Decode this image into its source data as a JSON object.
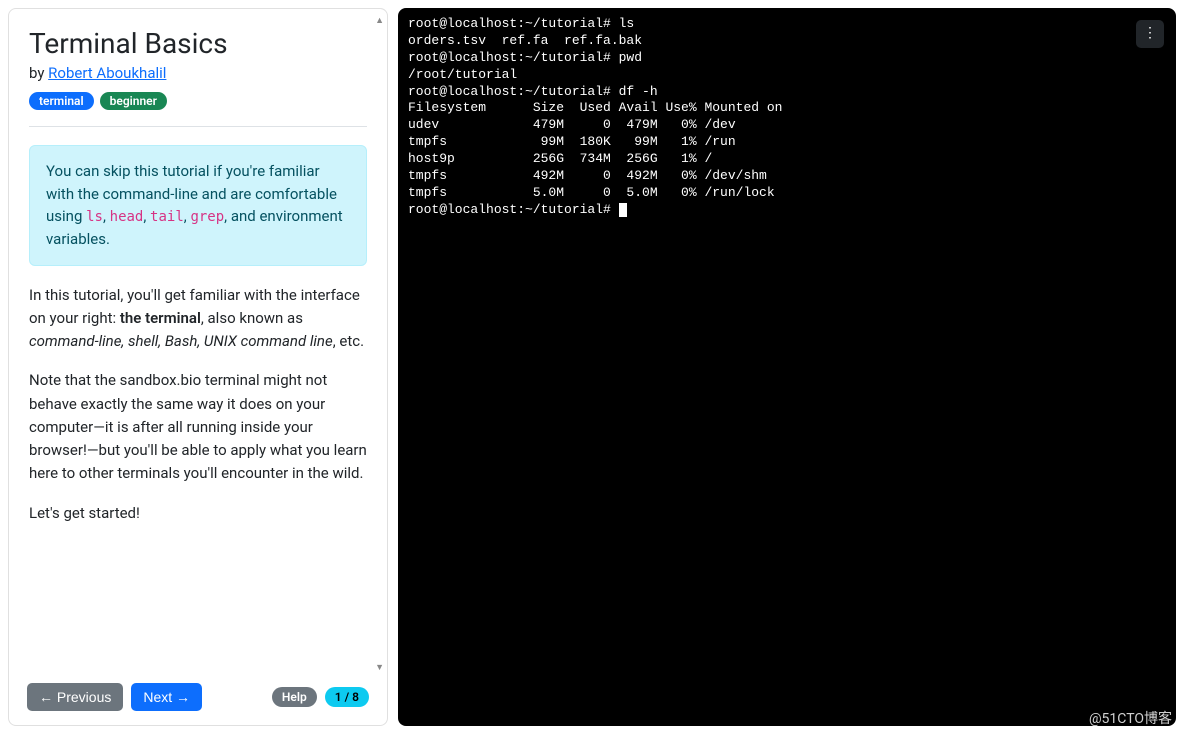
{
  "sidebar": {
    "title": "Terminal Basics",
    "by_prefix": "by ",
    "author_name": "Robert Aboukhalil",
    "tags": [
      "terminal",
      "beginner"
    ],
    "callout": {
      "pre": "You can skip this tutorial if you're familiar with the command-line and are comfortable using ",
      "codes": [
        "ls",
        "head",
        "tail",
        "grep"
      ],
      "post": ", and environment variables."
    },
    "para1_pre": "In this tutorial, you'll get familiar with the interface on your right: ",
    "para1_bold": "the terminal",
    "para1_mid": ", also known as ",
    "para1_em": "command-line, shell, Bash, UNIX command line",
    "para1_post": ", etc.",
    "para2": "Note that the sandbox.bio terminal might not behave exactly the same way it does on your computer—it is after all running inside your browser!—but you'll be able to apply what you learn here to other terminals you'll encounter in the wild.",
    "para3": "Let's get started!"
  },
  "footer": {
    "prev": "← Previous",
    "next": "Next →",
    "help": "Help",
    "progress": "1 / 8"
  },
  "terminal": {
    "prompt": "root@localhost:~/tutorial#",
    "lines": [
      "root@localhost:~/tutorial# ls",
      "orders.tsv  ref.fa  ref.fa.bak",
      "root@localhost:~/tutorial# pwd",
      "/root/tutorial",
      "root@localhost:~/tutorial# df -h",
      "Filesystem      Size  Used Avail Use% Mounted on",
      "udev            479M     0  479M   0% /dev",
      "tmpfs            99M  180K   99M   1% /run",
      "host9p          256G  734M  256G   1% /",
      "tmpfs           492M     0  492M   0% /dev/shm",
      "tmpfs           5.0M     0  5.0M   0% /run/lock"
    ],
    "final_prompt": "root@localhost:~/tutorial# "
  },
  "watermark": "@51CTO博客"
}
